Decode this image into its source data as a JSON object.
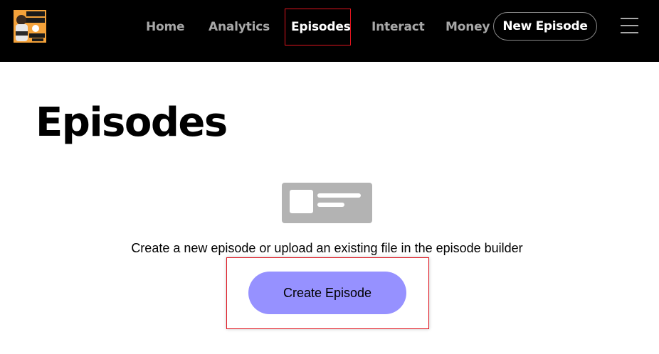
{
  "header": {
    "logo_icon": "podcast-cover-logo",
    "nav": [
      {
        "label": "Home",
        "active": false
      },
      {
        "label": "Analytics",
        "active": false
      },
      {
        "label": "Episodes",
        "active": true
      },
      {
        "label": "Interact",
        "active": false
      },
      {
        "label": "Money",
        "active": false
      }
    ],
    "new_episode_label": "New Episode",
    "menu_icon": "hamburger-menu-icon"
  },
  "main": {
    "title": "Episodes",
    "empty_state": {
      "illustration_icon": "episode-card-illustration",
      "message": "Create a new episode or upload an existing file in the episode builder",
      "cta_label": "Create Episode"
    }
  },
  "colors": {
    "header_bg": "#000000",
    "nav_inactive": "#a7a7a7",
    "nav_active": "#ffffff",
    "cta_bg": "#9691ff",
    "highlight_box": "#e0141e",
    "illustration_gray": "#b3b3b3"
  }
}
